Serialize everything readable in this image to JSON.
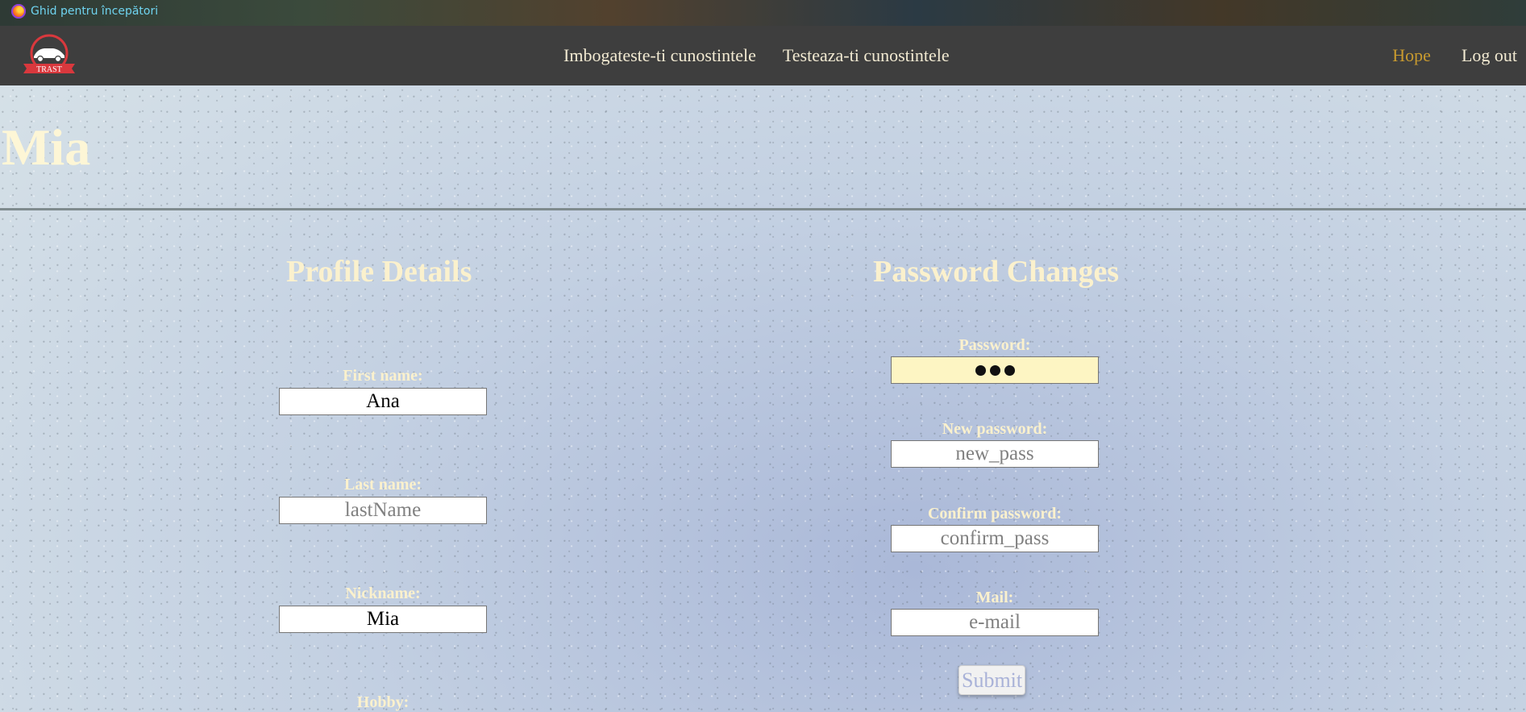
{
  "bookmarks": {
    "item_label": "Ghid pentru începători",
    "icon": "firefox-icon"
  },
  "nav": {
    "logo_text": "TRAST",
    "links": [
      "Imbogateste-ti cunostintele",
      "Testeaza-ti cunostintele"
    ],
    "user": "Hope",
    "logout": "Log out"
  },
  "page": {
    "title": "Mia"
  },
  "profile": {
    "title": "Profile Details",
    "first_name": {
      "label": "First name:",
      "value": "Ana",
      "placeholder": ""
    },
    "last_name": {
      "label": "Last name:",
      "value": "",
      "placeholder": "lastName"
    },
    "nickname": {
      "label": "Nickname:",
      "value": "Mia",
      "placeholder": ""
    },
    "hobby": {
      "label": "Hobby:"
    }
  },
  "password": {
    "title": "Password Changes",
    "current": {
      "label": "Password:",
      "masked_length": 3
    },
    "new": {
      "label": "New password:",
      "placeholder": "new_pass"
    },
    "confirm": {
      "label": "Confirm password:",
      "placeholder": "confirm_pass"
    },
    "mail": {
      "label": "Mail:",
      "placeholder": "e-mail"
    },
    "submit_label": "Submit"
  },
  "colors": {
    "navbar": "#3e3e3e",
    "nav_link": "#f2ead2",
    "active_user": "#c89a2f",
    "heading": "#fbf1cd",
    "autofill": "#fdf5c3",
    "logo_red": "#d9383d"
  }
}
